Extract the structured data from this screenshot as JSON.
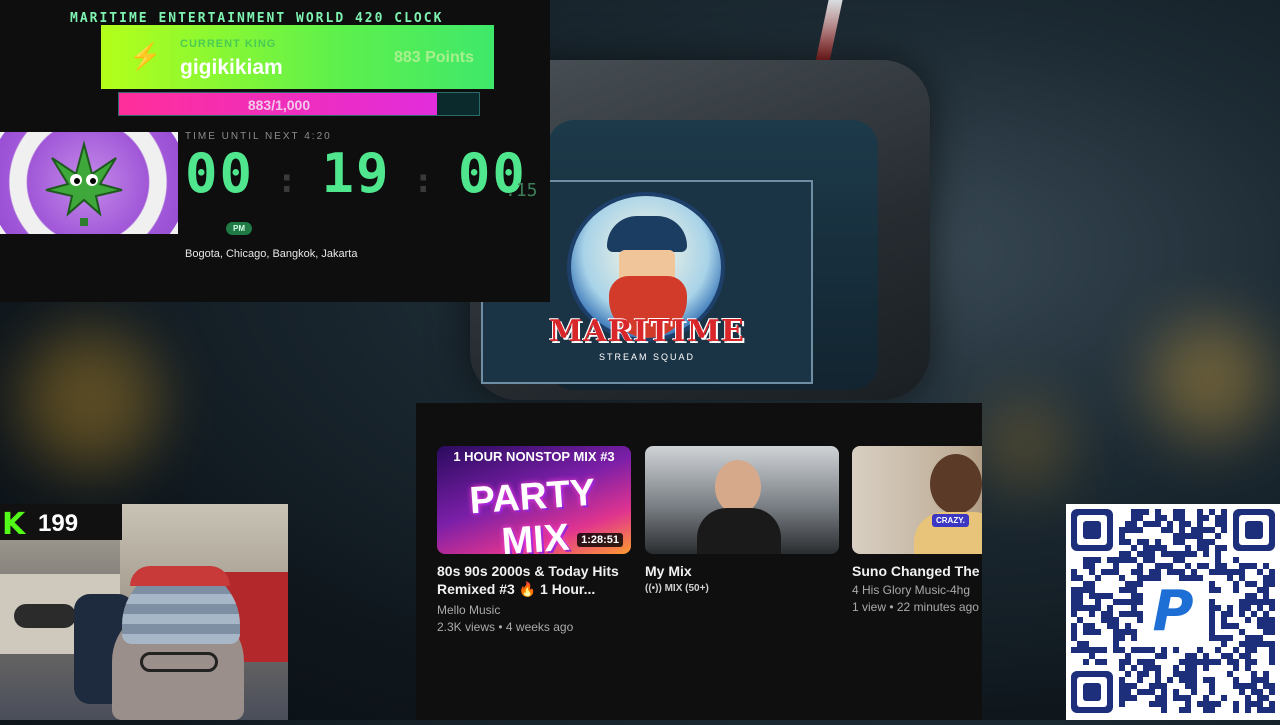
{
  "overlay": {
    "title": "MARITIME ENTERTAINMENT WORLD 420 CLOCK",
    "king": {
      "label": "CURRENT KING",
      "name": "gigikikiam",
      "points": "883 Points"
    },
    "progress": {
      "text": "883/1,000",
      "fraction": 0.883
    },
    "countdown": {
      "label": "TIME UNTIL NEXT 4:20",
      "hours": "00",
      "minutes": "19",
      "seconds": "00",
      "fraction": ".15",
      "meridiem": "PM",
      "cities": "Bogota, Chicago, Bangkok, Jakarta"
    }
  },
  "background": {
    "logo_title": "MARITIME",
    "logo_subtitle": "STREAM SQUAD"
  },
  "youtube": {
    "videos": [
      {
        "thumb_top": "1 HOUR NONSTOP MIX #3",
        "thumb_main": "PARTY MIX",
        "duration": "1:28:51",
        "title_line1": "80s 90s 2000s & Today Hits",
        "title_line2": "Remixed #3 🔥 1 Hour...",
        "channel": "Mello Music",
        "stats": "2.3K views • 4 weeks ago"
      },
      {
        "title_line1": "My Mix",
        "channel": "((•)) MIX (50+)"
      },
      {
        "thumb_tag": "CRAZY.",
        "title_line1": "Suno Changed The G",
        "channel": "4 His Glory Music-4hg",
        "stats": "1 view • 22 minutes ago"
      }
    ]
  },
  "webcam": {
    "kick_icon": "K",
    "viewer_count": "199"
  },
  "qr": {
    "icon": "paypal-icon"
  }
}
